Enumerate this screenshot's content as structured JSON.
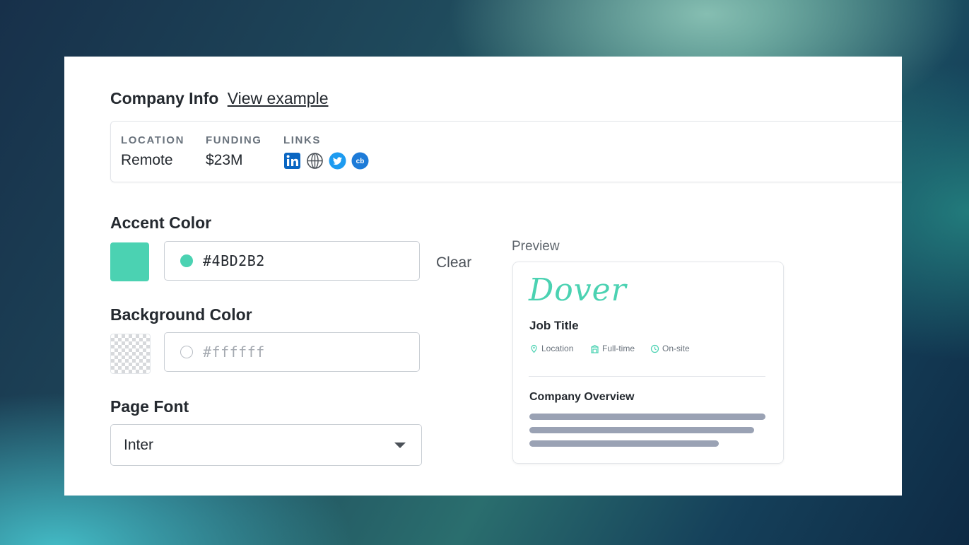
{
  "company_info": {
    "title": "Company Info",
    "view_example_link": "View example",
    "location_label": "LOCATION",
    "location_value": "Remote",
    "funding_label": "FUNDING",
    "funding_value": "$23M",
    "links_label": "LINKS",
    "links": [
      "linkedin-icon",
      "globe-icon",
      "twitter-icon",
      "crunchbase-icon"
    ]
  },
  "accent_color": {
    "title": "Accent Color",
    "value": "#4BD2B2",
    "swatch_color": "#4BD2B2",
    "clear_label": "Clear"
  },
  "background_color": {
    "title": "Background Color",
    "placeholder": "#ffffff"
  },
  "page_font": {
    "title": "Page Font",
    "selected": "Inter"
  },
  "preview": {
    "label": "Preview",
    "brand": "Dover",
    "job_title": "Job Title",
    "meta": [
      "Location",
      "Full-time",
      "On-site"
    ],
    "overview_title": "Company Overview"
  },
  "colors": {
    "accent": "#4BD2B2",
    "placeholder_bars": "#9aa2b4"
  }
}
